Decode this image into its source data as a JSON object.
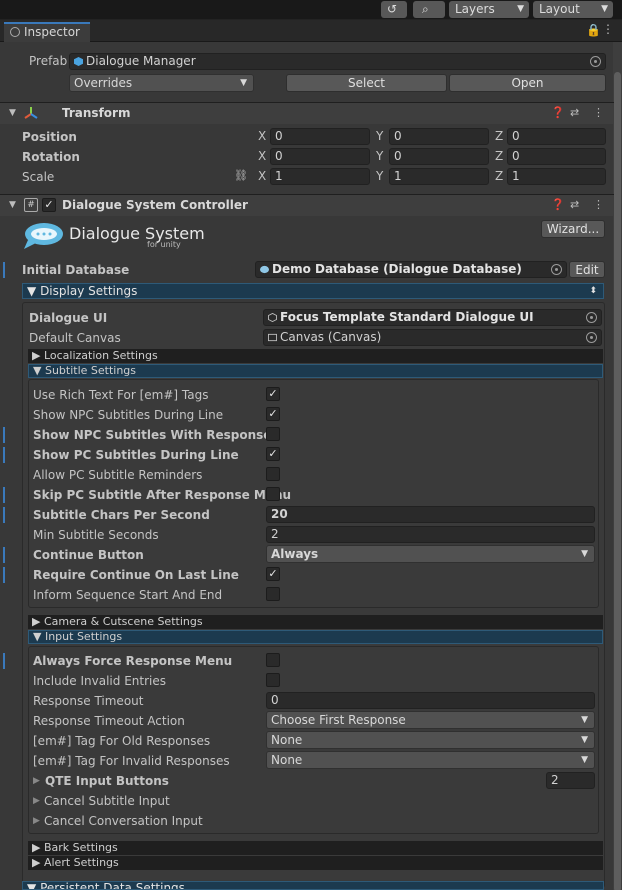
{
  "toolbar": {
    "layers_label": "Layers",
    "layout_label": "Layout"
  },
  "tab": {
    "title": "Inspector"
  },
  "prefab": {
    "label": "Prefab",
    "asset": "Dialogue Manager",
    "overrides": "Overrides",
    "select": "Select",
    "open": "Open"
  },
  "transform": {
    "title": "Transform",
    "rows": [
      {
        "label": "Position",
        "x": "0",
        "y": "0",
        "z": "0"
      },
      {
        "label": "Rotation",
        "x": "0",
        "y": "0",
        "z": "0"
      },
      {
        "label": "Scale",
        "x": "1",
        "y": "1",
        "z": "1"
      }
    ],
    "axis": {
      "x": "X",
      "y": "Y",
      "z": "Z"
    }
  },
  "controller": {
    "title": "Dialogue System Controller",
    "logo_title": "Dialogue System",
    "logo_sub": "for unity",
    "wizard": "Wizard...",
    "initial_db_label": "Initial Database",
    "initial_db_value": "Demo Database (Dialogue Database)",
    "edit": "Edit"
  },
  "display": {
    "title": "Display Settings",
    "dialogue_ui_label": "Dialogue UI",
    "dialogue_ui_value": "Focus Template Standard Dialogue UI",
    "default_canvas_label": "Default Canvas",
    "default_canvas_value": "Canvas (Canvas)",
    "localization": "Localization Settings",
    "subtitle": "Subtitle Settings",
    "camera": "Camera & Cutscene Settings",
    "input": "Input Settings",
    "bark": "Bark Settings",
    "alert": "Alert Settings",
    "persistent": "Persistent Data Settings"
  },
  "subtitle": {
    "rich_text": "Use Rich Text For [em#] Tags",
    "npc_during": "Show NPC Subtitles During Line",
    "npc_responses": "Show NPC Subtitles With Responses",
    "pc_during": "Show PC Subtitles During Line",
    "pc_reminders": "Allow PC Subtitle Reminders",
    "skip_pc": "Skip PC Subtitle After Response Menu",
    "chars_label": "Subtitle Chars Per Second",
    "chars_value": "20",
    "min_label": "Min Subtitle Seconds",
    "min_value": "2",
    "continue_label": "Continue Button",
    "continue_value": "Always",
    "require_last": "Require Continue On Last Line",
    "inform_seq": "Inform Sequence Start And End"
  },
  "input": {
    "force_menu": "Always Force Response Menu",
    "invalid_entries": "Include Invalid Entries",
    "timeout_label": "Response Timeout",
    "timeout_value": "0",
    "timeout_action_label": "Response Timeout Action",
    "timeout_action_value": "Choose First Response",
    "old_label": "[em#] Tag For Old Responses",
    "old_value": "None",
    "invalid_label": "[em#] Tag For Invalid Responses",
    "invalid_value": "None",
    "qte_label": "QTE Input Buttons",
    "qte_value": "2",
    "cancel_subtitle": "Cancel Subtitle Input",
    "cancel_conversation": "Cancel Conversation Input"
  },
  "colors": {
    "accent": "#3a79bb",
    "section": "#1c3a4f",
    "background": "#383838"
  }
}
